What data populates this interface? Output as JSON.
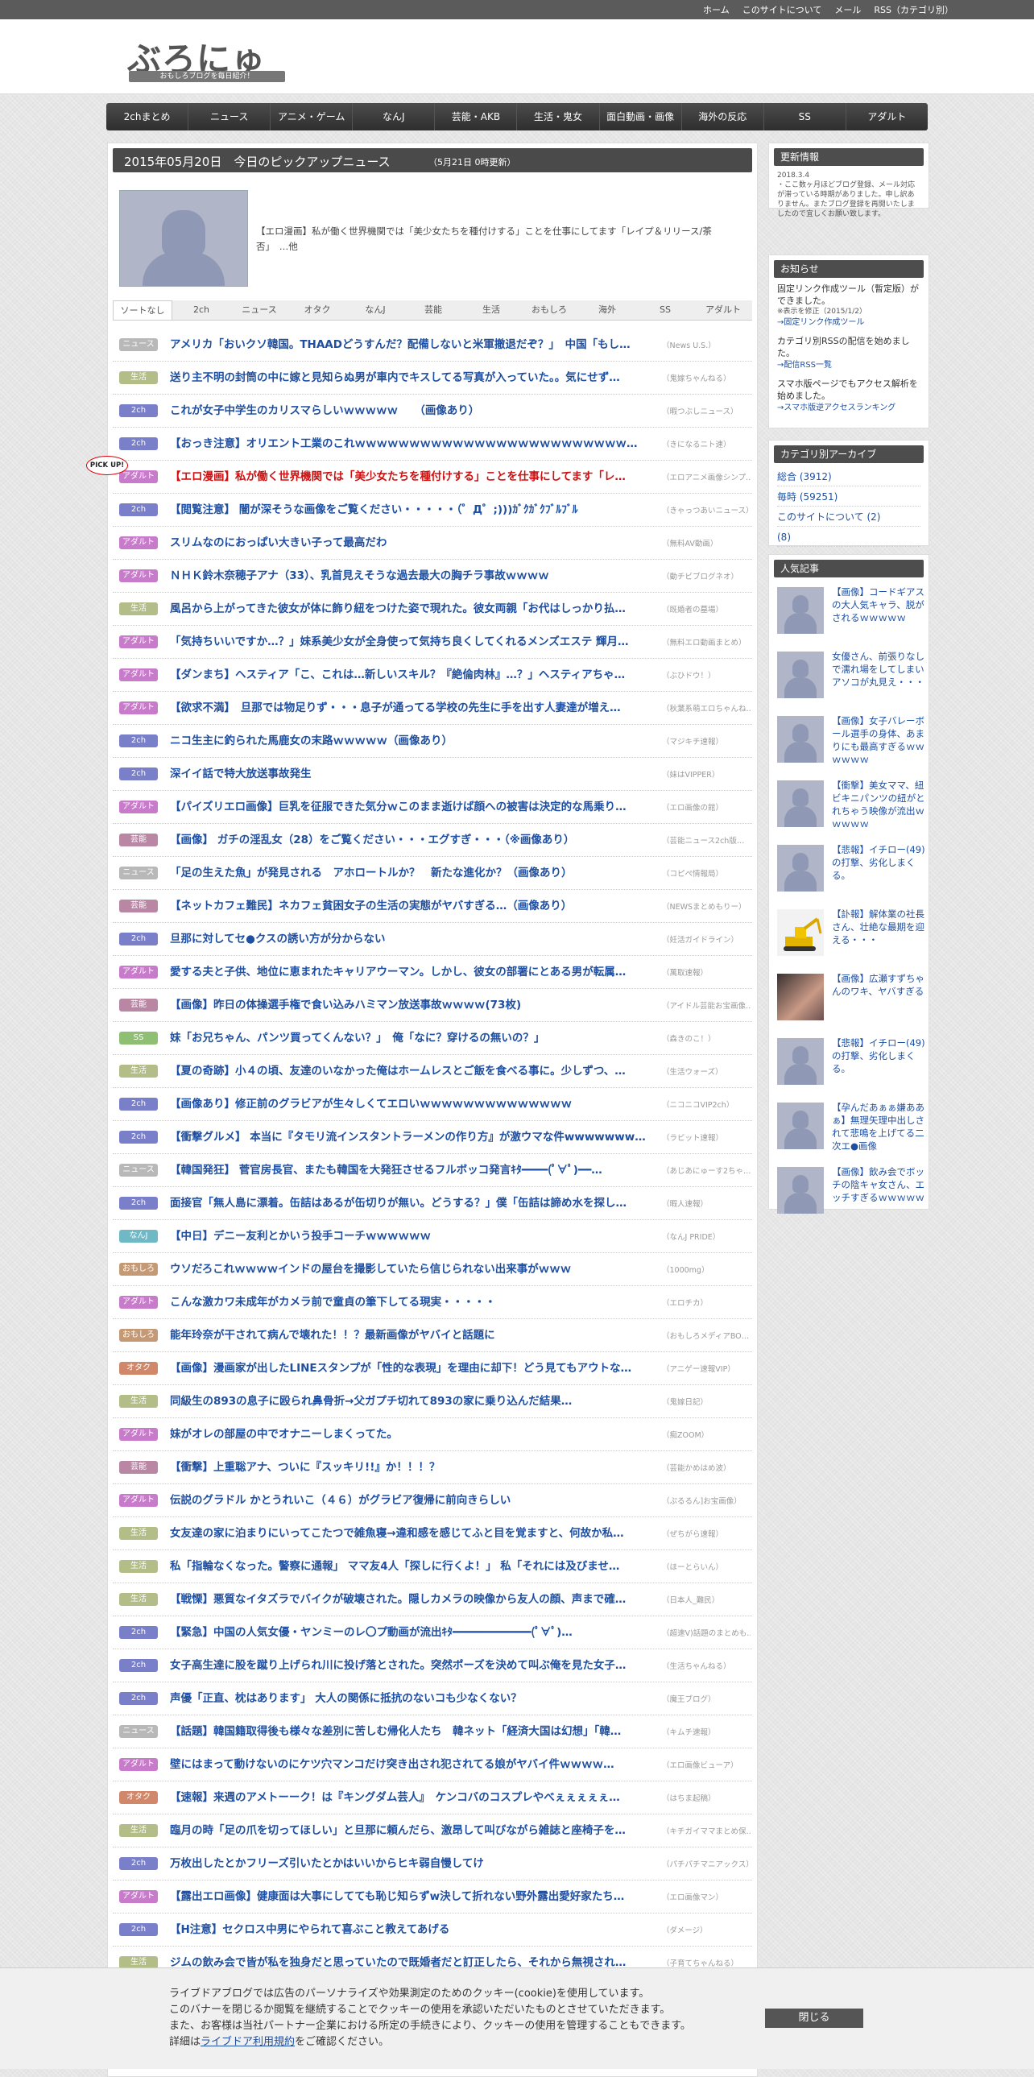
{
  "topbar": {
    "links": [
      "ホーム",
      "このサイトについて",
      "メール",
      "RSS（カテゴリ別）"
    ]
  },
  "site": {
    "title": "ぶろにゅー",
    "subtitle": "おもしろブログを毎日紹介！"
  },
  "nav": [
    "2chまとめ",
    "ニュース",
    "アニメ・ゲーム",
    "なんJ",
    "芸能・AKB",
    "生活・鬼女",
    "面白動画・画像",
    "海外の反応",
    "SS",
    "アダルト"
  ],
  "pickup": {
    "heading": "2015年05月20日　今日のピックアップニュース",
    "updated": "（5月21日 0時更新）",
    "feature_text": "【エロ漫画】私が働く世界機関では「美少女たちを種付けする」ことを仕事にしてます「レイプ＆リリース/茶否」　…他",
    "badge": "PICK UP!"
  },
  "tabs": [
    "ソートなし",
    "2ch",
    "ニュース",
    "オタク",
    "なんJ",
    "芸能",
    "生活",
    "おもしろ",
    "海外",
    "SS",
    "アダルト"
  ],
  "category_colors": {
    "ニュース": "#b8b8b8",
    "生活": "#b3bd88",
    "2ch": "#7a7fc9",
    "アダルト": "#c97bcb",
    "芸能": "#b986a4",
    "SS": "#8fbf73",
    "なんJ": "#6fb9c6",
    "おもしろ": "#c49a76",
    "オタク": "#d1886a"
  },
  "articles": [
    {
      "cat": "ニュース",
      "title": "アメリカ「おいクソ韓国。THAADどうすんだ？配備しないと米軍撤退だぞ？」　中国「もし…",
      "src": "（News U.S.）",
      "red": false
    },
    {
      "cat": "生活",
      "title": "送り主不明の封筒の中に嫁と見知らぬ男が車内でキスしてる写真が入っていた。。気にせず…",
      "src": "（鬼嫁ちゃんねる）",
      "red": false
    },
    {
      "cat": "2ch",
      "title": "これが女子中学生のカリスマらしいｗｗｗｗｗ　　（画像あり）",
      "src": "（暇つぶしニュース）",
      "red": false
    },
    {
      "cat": "2ch",
      "title": "【おっき注意】オリエント工業のこれｗｗｗｗｗｗｗｗｗｗｗｗｗｗｗｗｗｗｗｗｗｗｗｗｗ…",
      "src": "（きになるニト速）",
      "red": false
    },
    {
      "cat": "アダルト",
      "title": "【エロ漫画】私が働く世界機関では「美少女たちを種付けする」ことを仕事にしてます「レ…",
      "src": "（エロアニメ画像シンプ…",
      "red": true
    },
    {
      "cat": "2ch",
      "title": "【閲覧注意】 闇が深そうな画像をご覧ください・・・・・（゜Д゜;)))ｶﾞｸｶﾞｸﾌﾞﾙﾌﾞﾙ",
      "src": "（きゃっつあいニュース）",
      "red": false
    },
    {
      "cat": "アダルト",
      "title": "スリムなのにおっぱい大きい子って最高だわ",
      "src": "（無料AV動画）",
      "red": false
    },
    {
      "cat": "アダルト",
      "title": "ＮＨＫ鈴木奈穂子アナ（33）、乳首見えそうな過去最大の胸チラ事故ｗｗｗｗ",
      "src": "（動チビブログネオ）",
      "red": false
    },
    {
      "cat": "生活",
      "title": "風呂から上がってきた彼女が体に飾り紐をつけた姿で現れた。彼女両親「お代はしっかり払…",
      "src": "（既婚者の墓場）",
      "red": false
    },
    {
      "cat": "アダルト",
      "title": "「気持ちいいですか…？」妹系美少女が全身使って気持ち良くしてくれるメンズエステ 輝月…",
      "src": "（無料エロ動画まとめ）",
      "red": false
    },
    {
      "cat": "アダルト",
      "title": "【ダンまち】ヘスティア「こ、これは…新しいスキル？『絶倫肉林』…？」ヘスティアちゃ…",
      "src": "（ぶひドウ！）",
      "red": false
    },
    {
      "cat": "アダルト",
      "title": "【欲求不満】　旦那では物足りず・・・息子が通ってる学校の先生に手を出す人妻達が増え…",
      "src": "（秋葉系萌エロちゃんね…",
      "red": false
    },
    {
      "cat": "2ch",
      "title": "ニコ生主に釣られた馬鹿女の末路ｗｗｗｗｗ（画像あり）",
      "src": "（マジキチ速報）",
      "red": false
    },
    {
      "cat": "2ch",
      "title": "深イイ話で特大放送事故発生",
      "src": "（妹はVIPPER）",
      "red": false
    },
    {
      "cat": "アダルト",
      "title": "【パイズリエロ画像】巨乳を征服できた気分ｗこのまま逝けば顔への被害は決定的な馬乗り…",
      "src": "（エロ画像の館）",
      "red": false
    },
    {
      "cat": "芸能",
      "title": "【画像】 ガチの淫乱女（28）をご覧ください・・・エグすぎ・・・（※画像あり）",
      "src": "（芸能ニュース2ch版…",
      "red": false
    },
    {
      "cat": "ニュース",
      "title": "「足の生えた魚」が発見される　アホロートルか？　新たな進化か？（画像あり）",
      "src": "（コピペ情報局）",
      "red": false
    },
    {
      "cat": "芸能",
      "title": "【ネットカフェ難民】ネカフェ貧困女子の生活の実態がヤバすぎる…（画像あり）",
      "src": "（NEWSまとめもりー）",
      "red": false
    },
    {
      "cat": "2ch",
      "title": "旦那に対してセ●クスの誘い方が分からない",
      "src": "（妊活ガイドライン）",
      "red": false
    },
    {
      "cat": "アダルト",
      "title": "愛する夫と子供、地位に恵まれたキャリアウーマン。しかし、彼女の部署にとある男が転属…",
      "src": "（萬取速報）",
      "red": false
    },
    {
      "cat": "芸能",
      "title": "【画像】昨日の体操選手権で食い込みハミマン放送事故ｗｗｗｗ(73枚)",
      "src": "（アイドル芸能お宝画像…",
      "red": false
    },
    {
      "cat": "SS",
      "title": "妹「お兄ちゃん、パンツ買ってくんない？」　俺「なに？穿けるの無いの？」",
      "src": "（森きのこ！）",
      "red": false
    },
    {
      "cat": "生活",
      "title": "【夏の奇跡】小４の頃、友達のいなかった俺はホームレスとご飯を食べる事に。少しずつ、…",
      "src": "（生活ウォーズ）",
      "red": false
    },
    {
      "cat": "2ch",
      "title": "【画像あり】修正前のグラビアが生々しくてエロいｗｗｗｗｗｗｗｗｗｗｗｗｗｗ",
      "src": "（ニコニコVIP2ch）",
      "red": false
    },
    {
      "cat": "2ch",
      "title": "【衝撃グルメ】 本当に『タモリ流インスタントラーメンの作り方』が激ウマな件wwwwwww…",
      "src": "（ラビット速報）",
      "red": false
    },
    {
      "cat": "ニュース",
      "title": "【韓国発狂】 菅官房長官、またも韓国を大発狂させるフルボッコ発言ｷﾀ━━━━(ﾟ∀ﾟ)━━…",
      "src": "（あじあにゅーす2ちゃ…",
      "red": false
    },
    {
      "cat": "2ch",
      "title": "面接官「無人島に漂着。缶詰はあるが缶切りが無い。どうする？」僕「缶詰は諦め水を探し…",
      "src": "（暇人速報）",
      "red": false
    },
    {
      "cat": "なんJ",
      "title": "【中日】デニー友利とかいう投手コーチｗｗｗｗｗｗ",
      "src": "（なんJ PRIDE）",
      "red": false
    },
    {
      "cat": "おもしろ",
      "title": "ウソだろこれｗｗｗｗインドの屋台を撮影していたら信じられない出来事がｗｗｗ",
      "src": "（1000mg）",
      "red": false
    },
    {
      "cat": "アダルト",
      "title": "こんな激カワ未成年がカメラ前で童貞の筆下してる現実・・・・・",
      "src": "（エロチカ）",
      "red": false
    },
    {
      "cat": "おもしろ",
      "title": "能年玲奈が干されて病んで壊れた！！？最新画像がヤバイと話題に",
      "src": "（おもしろメディアBO…",
      "red": false
    },
    {
      "cat": "オタク",
      "title": "【画像】漫画家が出したLINEスタンプが「性的な表現」を理由に却下！どう見てもアウトな…",
      "src": "（アニゲー速報VIP）",
      "red": false
    },
    {
      "cat": "生活",
      "title": "同級生の893の息子に殴られ鼻骨折→父ガプチ切れて893の家に乗り込んだ結果…",
      "src": "（鬼嫁日記）",
      "red": false
    },
    {
      "cat": "アダルト",
      "title": "妹がオレの部屋の中でオナニーしまくってた。",
      "src": "（痴ZOOM）",
      "red": false
    },
    {
      "cat": "芸能",
      "title": "【衝撃】上重聡アナ、ついに『スッキリ!!』か！！！？",
      "src": "（芸能かめはめ波）",
      "red": false
    },
    {
      "cat": "アダルト",
      "title": "伝説のグラドル かとうれいこ（４６）がグラビア復帰に前向きらしい",
      "src": "（ぷるるん]お宝画像）",
      "red": false
    },
    {
      "cat": "生活",
      "title": "女友達の家に泊まりにいってこたつで雑魚寝→違和感を感じてふと目を覚ますと、何故か私…",
      "src": "（ぜちがら速報）",
      "red": false
    },
    {
      "cat": "生活",
      "title": "私「指輪なくなった。警察に通報」 ママ友4人「探しに行くよ！」 私「それには及びませ…",
      "src": "（ほーとらいん）",
      "red": false
    },
    {
      "cat": "生活",
      "title": "【戦慄】悪質なイタズラでバイクが破壊された。隠しカメラの映像から友人の顔、声まで確…",
      "src": "（日本人_難民）",
      "red": false
    },
    {
      "cat": "2ch",
      "title": "【緊急】中国の人気女優・ヤンミーのレ〇プ動画が流出ｷﾀ━━━━━━━━━━━━(ﾟ∀ﾟ)…",
      "src": "（超速V)話題のまとめも…",
      "red": false
    },
    {
      "cat": "2ch",
      "title": "女子高生達に股を蹴り上げられ川に投げ落とされた。突然ポーズを決めて叫ぶ俺を見た女子…",
      "src": "（生活ちゃんねる）",
      "red": false
    },
    {
      "cat": "2ch",
      "title": "声優「正直、枕はあります」 大人の関係に抵抗のないコも少なくない？",
      "src": "（魔王ブログ）",
      "red": false
    },
    {
      "cat": "ニュース",
      "title": "【話題】韓国籍取得後も様々な差別に苦しむ帰化人たち　韓ネット「経済大国は幻想」「韓…",
      "src": "（キムチ速報）",
      "red": false
    },
    {
      "cat": "アダルト",
      "title": "壁にはまって動けないのにケツ穴マンコだけ突き出され犯されてる娘がヤバイ件ｗｗｗｗ…",
      "src": "（エロ画像ビューア）",
      "red": false
    },
    {
      "cat": "オタク",
      "title": "【速報】来週のアメトーーク！は『キングダム芸人』　ケンコバのコスプレやべぇぇぇぇぇ…",
      "src": "（はちま起稿）",
      "red": false
    },
    {
      "cat": "生活",
      "title": "臨月の時「足の爪を切ってほしい」と旦那に頼んだら、激昂して叫びながら雑誌と座椅子を…",
      "src": "（キチガイママまとめ保…",
      "red": false
    },
    {
      "cat": "2ch",
      "title": "万枚出したとかフリーズ引いたとかはいいからヒキ弱自慢してけ",
      "src": "（パチパチマニアックス）",
      "red": false
    },
    {
      "cat": "アダルト",
      "title": "【露出エロ画像】健康面は大事にしてても恥じ知らずw決して折れない野外露出愛好家たち…",
      "src": "（エロ画像マン）",
      "red": false
    },
    {
      "cat": "2ch",
      "title": "【H注意】セクロス中男にやられて喜ぶこと教えてあげる",
      "src": "（ダメージ）",
      "red": false
    },
    {
      "cat": "生活",
      "title": "ジムの飲み会で皆が私を独身だと思っていたので既婚者だと訂正したら、それから無視され…",
      "src": "（子育てちゃんねる）",
      "red": false
    }
  ],
  "sidebar": {
    "updates": {
      "heading": "更新情報",
      "date": "2018.3.4",
      "text": "・ここ数ヶ月ほどブログ登録、メール対応が滞っている時期がありました。申し訳ありません。またブログ登録を再開いたしましたので宜しくお願い致します。"
    },
    "notice": {
      "heading": "お知らせ",
      "p1": "固定リンク作成ツール（暫定版）ができました。",
      "p1_note": "※表示を修正（2015/1/2）",
      "p1_link": "→固定リンク作成ツール",
      "p2": "カテゴリ別RSSの配信を始めました。",
      "p2_link": "→配信RSS一覧",
      "p3": "スマホ版ページでもアクセス解析を始めました。",
      "p3_link": "→スマホ版逆アクセスランキング"
    },
    "archive": {
      "heading": "カテゴリ別アーカイブ",
      "items": [
        "総合 (3912)",
        "毎時 (59251)",
        "このサイトについて (2)",
        "(8)"
      ]
    },
    "popular": {
      "heading": "人気記事",
      "items": [
        {
          "text": "【画像】コードギアスの大人気キャラ、脱がされるｗｗｗｗｗ",
          "thumb": "placeholder"
        },
        {
          "text": "女優さん、前張りなしで濡れ場をしてしまいアソコが丸見え・・・",
          "thumb": "placeholder"
        },
        {
          "text": "【画像】女子バレーボール選手の身体、あまりにも最高すぎるｗｗｗｗｗｗ",
          "thumb": "placeholder"
        },
        {
          "text": "【衝撃】美女ママ、紐ビキニパンツの紐がとれちゃう映像が流出ｗｗｗｗｗ",
          "thumb": "placeholder"
        },
        {
          "text": "【悲報】イチロー(49)の打撃、劣化しまくる。",
          "thumb": "placeholder"
        },
        {
          "text": "【訃報】解体業の社長さん、壮絶な最期を迎える・・・",
          "thumb": "excavator"
        },
        {
          "text": "【画像】広瀬すずちゃんのワキ、ヤバすぎる",
          "thumb": "photo"
        },
        {
          "text": "【悲報】イチロー(49)の打撃、劣化しまくる。",
          "thumb": "placeholder"
        },
        {
          "text": "【孕んだあぁぁ嫌ああぁ】無理矢理中出しされて悲鳴を上げてる二次エ●画像",
          "thumb": "placeholder"
        },
        {
          "text": "【画像】飲み会でボッチの陰キャ女さん、エッチすぎるｗｗｗｗｗ",
          "thumb": "placeholder"
        }
      ]
    }
  },
  "cookie": {
    "line1": "ライブドアブログでは広告のパーソナライズや効果測定のためのクッキー(cookie)を使用しています。",
    "line2": "このバナーを閉じるか閲覧を継続することでクッキーの使用を承認いただいたものとさせていただきます。",
    "line3": "また、お客様は当社パートナー企業における所定の手続きにより、クッキーの使用を管理することもできます。",
    "line4_pre": "詳細は",
    "line4_link": "ライブドア利用規約",
    "line4_post": "をご確認ください。",
    "close": "閉じる"
  }
}
